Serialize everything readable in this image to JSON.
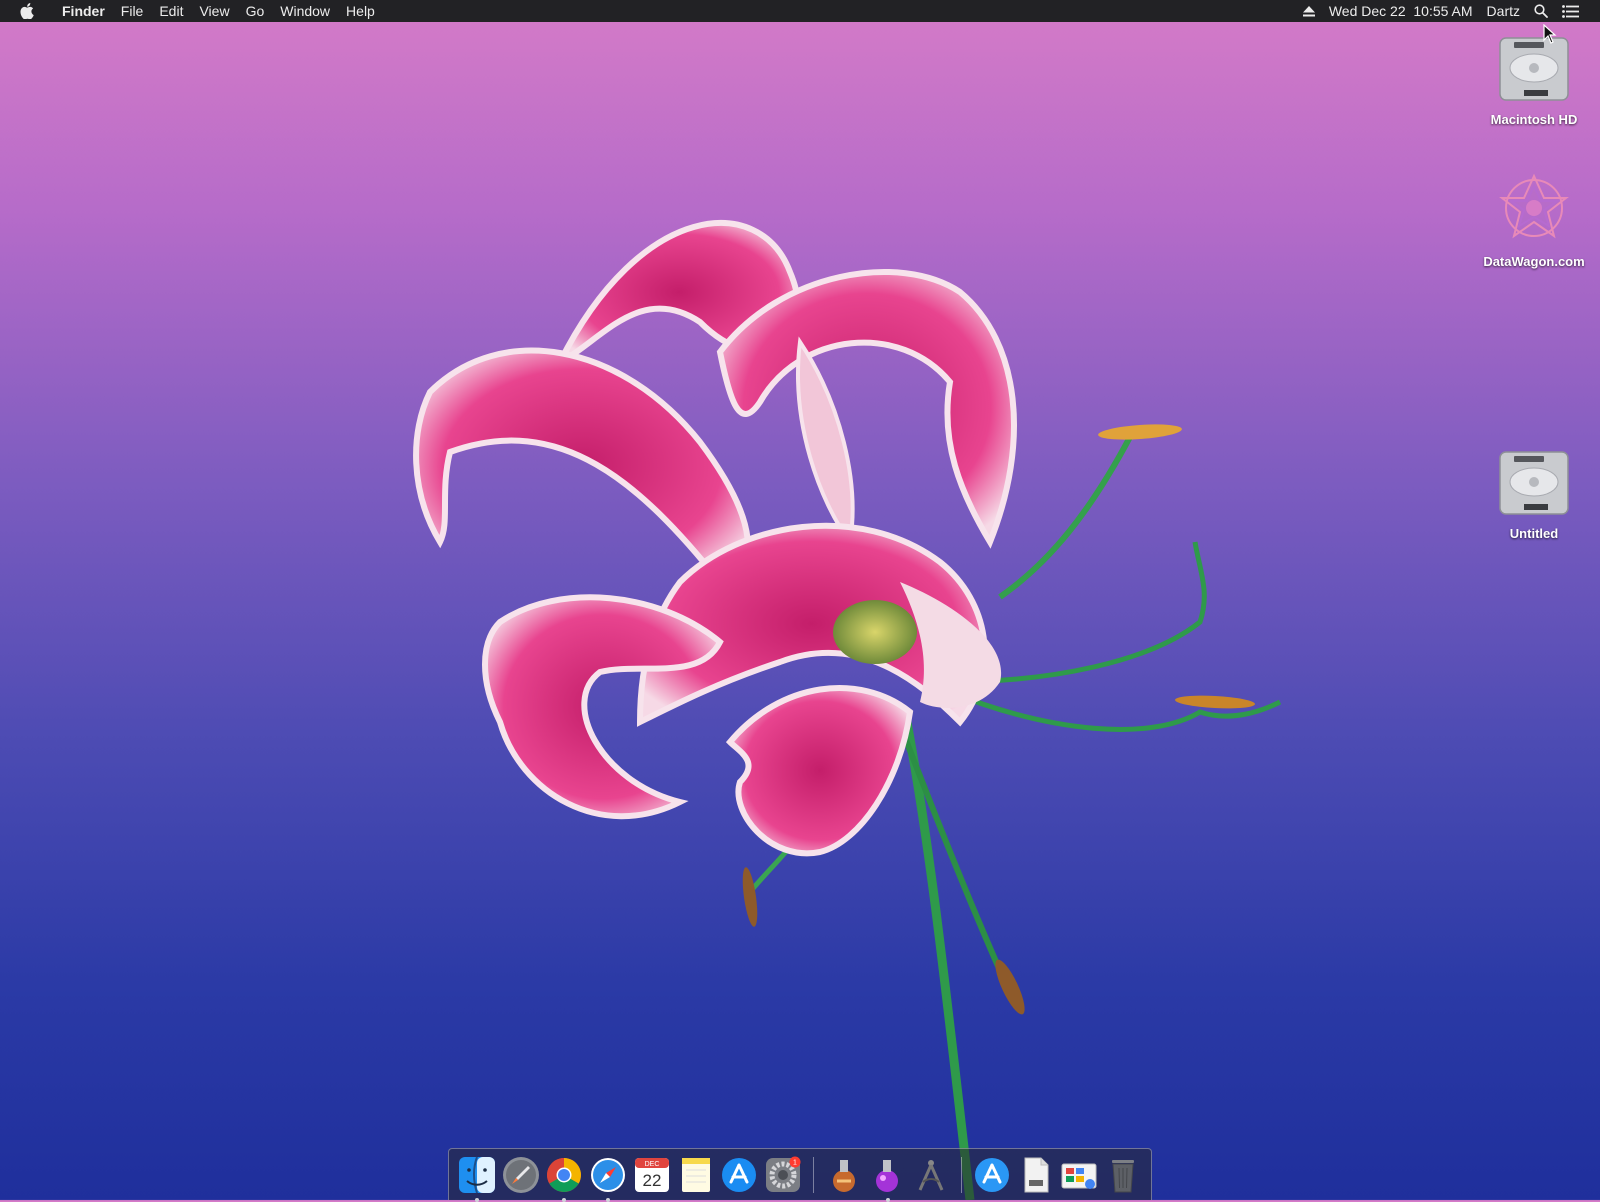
{
  "menubar": {
    "app_name": "Finder",
    "menus": [
      "File",
      "Edit",
      "View",
      "Go",
      "Window",
      "Help"
    ],
    "clock": "Wed Dec 22  10:55 AM",
    "user": "Dartz",
    "icons": [
      "apple-icon",
      "eject-icon",
      "spotlight-search-icon",
      "notification-center-icon"
    ]
  },
  "desktop": {
    "icons": [
      {
        "label": "Macintosh HD",
        "icon": "hard-drive-icon"
      },
      {
        "label": "DataWagon.com",
        "icon": "datawagon-logo-icon"
      },
      {
        "label": "Untitled",
        "icon": "hard-drive-icon"
      }
    ]
  },
  "dock": {
    "apps": [
      {
        "name": "Finder",
        "icon": "finder-icon",
        "running": true
      },
      {
        "name": "Launchpad",
        "icon": "launchpad-rocket-icon",
        "running": false
      },
      {
        "name": "Google Chrome",
        "icon": "chrome-icon",
        "running": true
      },
      {
        "name": "Safari",
        "icon": "safari-compass-icon",
        "running": true
      },
      {
        "name": "Calendar",
        "icon": "calendar-icon",
        "running": false,
        "month": "DEC",
        "day": "22"
      },
      {
        "name": "Notes",
        "icon": "notes-icon",
        "running": false
      },
      {
        "name": "App Store",
        "icon": "app-store-icon",
        "running": false
      },
      {
        "name": "System Preferences",
        "icon": "gear-icon",
        "running": false,
        "badge": "1"
      },
      {
        "name": "Install macOS",
        "icon": "installer-icon",
        "running": false
      },
      {
        "name": "Installer",
        "icon": "installer-purple-icon",
        "running": true
      },
      {
        "name": "Utility",
        "icon": "compass-tool-icon",
        "running": false
      },
      {
        "name": "App Store Folder",
        "icon": "app-store-icon",
        "running": false
      },
      {
        "name": "Document",
        "icon": "document-icon",
        "running": false
      },
      {
        "name": "Chrome Apps",
        "icon": "chrome-apps-icon",
        "running": false
      },
      {
        "name": "Trash",
        "icon": "trash-icon",
        "running": false
      }
    ]
  },
  "colors": {
    "menubar_bg": "#222225",
    "petal_pink": "#e03a85",
    "stem_green": "#2f9a4a"
  }
}
